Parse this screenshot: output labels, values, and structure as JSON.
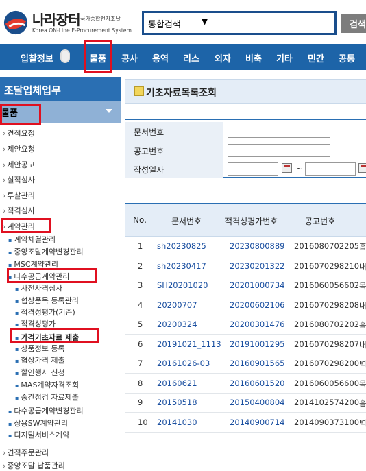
{
  "header": {
    "logo_main": "나라장터",
    "logo_sub1": "국가종합전자조달",
    "logo_sub2": "Korea ON-Line E-Procurement System",
    "search_select": "통합검색",
    "search_button": "검색"
  },
  "gnb": {
    "first": "입찰정보",
    "items": [
      "물품",
      "공사",
      "용역",
      "리스",
      "외자",
      "비축",
      "기타",
      "민간",
      "공통"
    ]
  },
  "sidebar": {
    "title": "조달업체업무",
    "category": "물품",
    "menu": [
      {
        "label": "견적요청",
        "level": 1
      },
      {
        "label": "제안요청",
        "level": 1
      },
      {
        "label": "제안공고",
        "level": 1
      },
      {
        "label": "실적심사",
        "level": 1
      },
      {
        "label": "투찰관리",
        "level": 1
      },
      {
        "label": "적격심사",
        "level": 1
      },
      {
        "label": "계약관리",
        "level": 1
      },
      {
        "label": "계약체결관리",
        "level": 2
      },
      {
        "label": "중앙조달계약변경관리",
        "level": 2
      },
      {
        "label": "MSC계약관리",
        "level": 2
      },
      {
        "label": "다수공급계약관리",
        "level": 2
      },
      {
        "label": "사전사격심사",
        "level": 3
      },
      {
        "label": "협상품목 등록관리",
        "level": 3
      },
      {
        "label": "적격성평가(기존)",
        "level": 3
      },
      {
        "label": "적격성평가",
        "level": 3
      },
      {
        "label": "가격기초자료 제출",
        "level": 3
      },
      {
        "label": "상품정보 등록",
        "level": 3
      },
      {
        "label": "협상가격 제출",
        "level": 3
      },
      {
        "label": "할인행사 신청",
        "level": 3
      },
      {
        "label": "MAS계약자격조회",
        "level": 3
      },
      {
        "label": "중간점검 자료제출",
        "level": 3
      },
      {
        "label": "다수공급계약변경관리",
        "level": 2
      },
      {
        "label": "상용SW계약관리",
        "level": 2
      },
      {
        "label": "디지털서비스계약",
        "level": 2
      },
      {
        "label": "견적주문관리",
        "level": 1
      },
      {
        "label": "중앙조달 납품관리",
        "level": 1
      }
    ]
  },
  "page": {
    "title": "기초자료목록조회",
    "form": {
      "doc_no_label": "문서번호",
      "notice_no_label": "공고번호",
      "date_label": "작성일자",
      "tilde": "~"
    },
    "table": {
      "headers": [
        "No.",
        "문서번호",
        "적격성평가번호",
        "공고번호"
      ],
      "rows": [
        {
          "no": "1",
          "doc": "sh20230825",
          "eval": "20230800889",
          "notice": "2016080702205",
          "extra": "흡"
        },
        {
          "no": "2",
          "doc": "sh20230417",
          "eval": "20230201322",
          "notice": "2016070298210",
          "extra": "내"
        },
        {
          "no": "3",
          "doc": "SH20201020",
          "eval": "20201000734",
          "notice": "2016060056602",
          "extra": "목"
        },
        {
          "no": "4",
          "doc": "20200707",
          "eval": "20200602106",
          "notice": "2016070298208",
          "extra": "내"
        },
        {
          "no": "5",
          "doc": "20200324",
          "eval": "20200301476",
          "notice": "2016080702202",
          "extra": "흡"
        },
        {
          "no": "6",
          "doc": "20191021_1113",
          "eval": "20191001295",
          "notice": "2016070298207",
          "extra": "내"
        },
        {
          "no": "7",
          "doc": "20161026-03",
          "eval": "20160901565",
          "notice": "2016070298200",
          "extra": "벽"
        },
        {
          "no": "8",
          "doc": "20160621",
          "eval": "20160601520",
          "notice": "2016060056600",
          "extra": "목"
        },
        {
          "no": "9",
          "doc": "20150518",
          "eval": "20150400804",
          "notice": "2014102574200",
          "extra": "흡"
        },
        {
          "no": "10",
          "doc": "20141030",
          "eval": "20140900714",
          "notice": "2014090373100",
          "extra": "벽"
        }
      ]
    }
  },
  "colors": {
    "nav_blue": "#1d64a8",
    "sidebar_title": "#2a6fb3",
    "highlight_red": "#e01020",
    "link_blue": "#1a4fa0"
  }
}
